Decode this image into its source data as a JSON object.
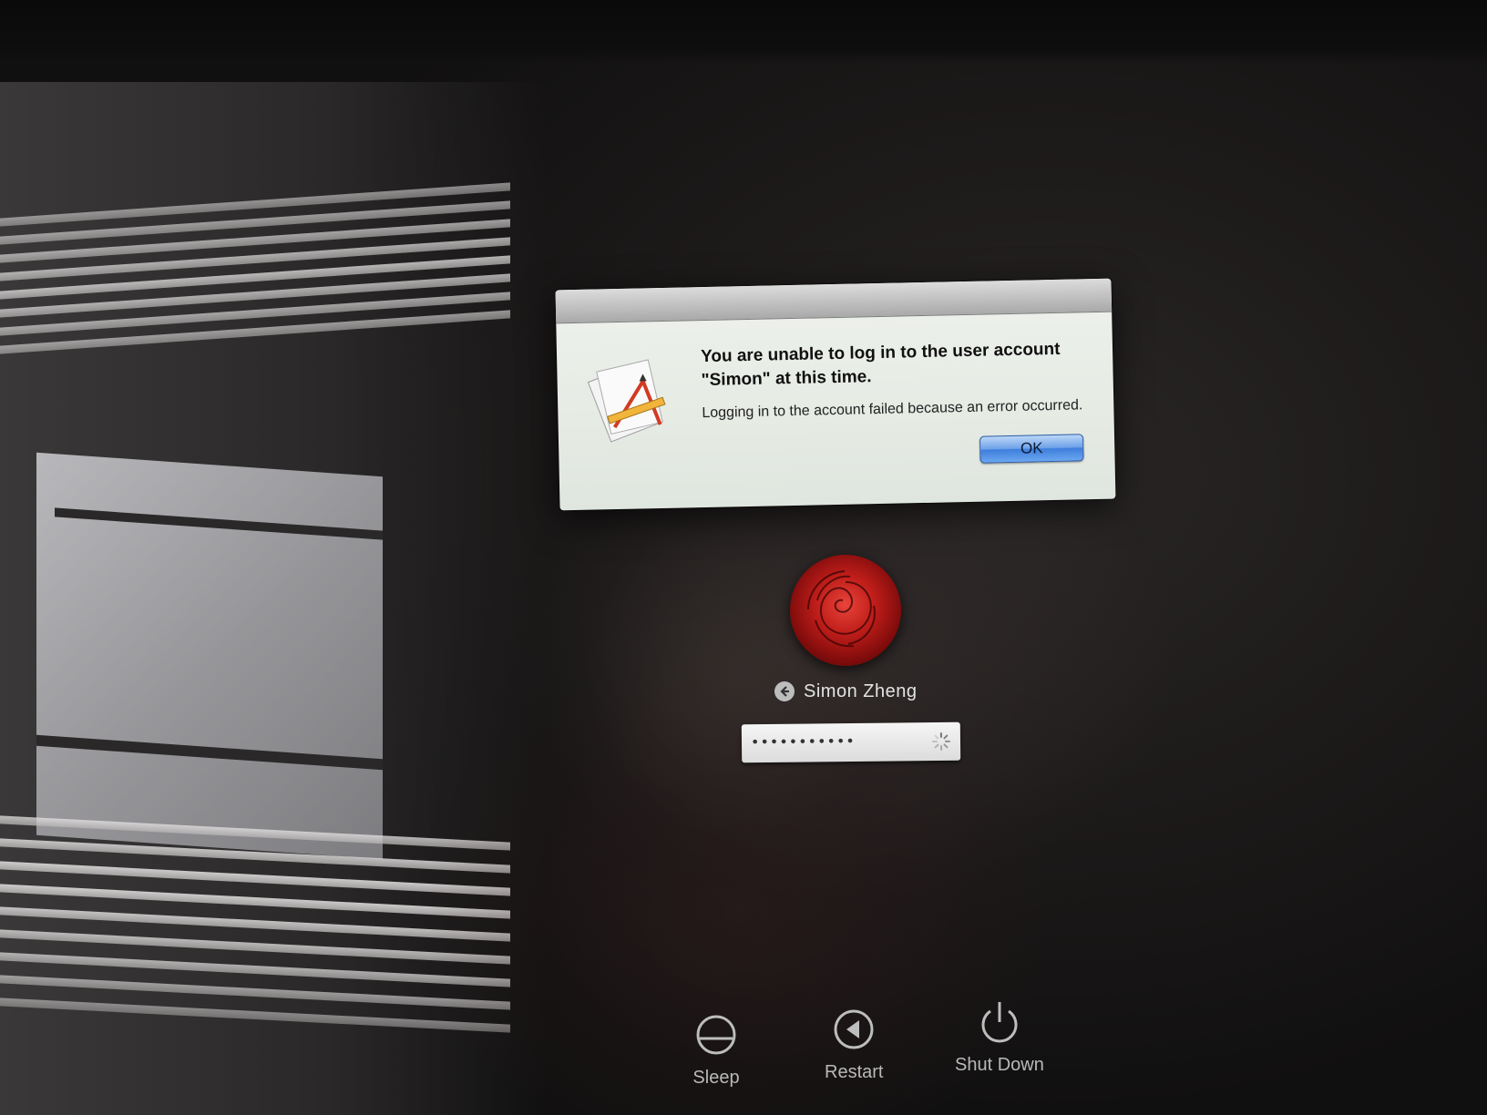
{
  "alert": {
    "title": "You are unable to log in to the user account \"Simon\" at this time.",
    "message": "Logging in to the account failed because an error occurred.",
    "ok_label": "OK",
    "icon": "app-icon-pencil-ruler"
  },
  "login": {
    "avatar_icon": "rose-avatar",
    "back_icon": "back-arrow-icon",
    "user_name": "Simon Zheng",
    "password_mask": "•••••••••••",
    "spinner_icon": "spinner-icon"
  },
  "controls": [
    {
      "label": "Sleep",
      "icon": "sleep-icon"
    },
    {
      "label": "Restart",
      "icon": "restart-icon"
    },
    {
      "label": "Shut Down",
      "icon": "power-icon"
    }
  ],
  "colors": {
    "ok_button": "#3f7fdc",
    "avatar": "#c01e1a",
    "background": "#1c1919"
  }
}
